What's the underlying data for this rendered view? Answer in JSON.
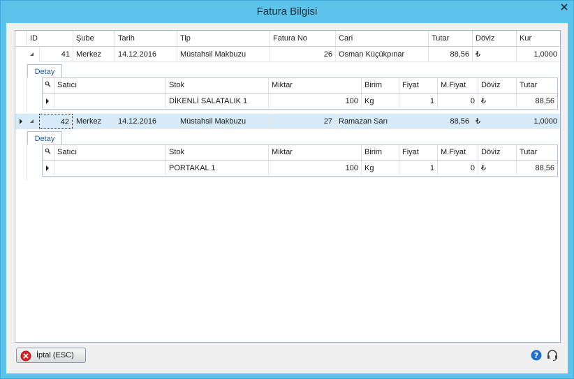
{
  "window": {
    "title": "Fatura Bilgisi"
  },
  "grid": {
    "columns": [
      "ID",
      "Şube",
      "Tarih",
      "Tip",
      "Fatura No",
      "Cari",
      "Tutar",
      "Döviz",
      "Kur"
    ],
    "rows": [
      {
        "id": "41",
        "sube": "Merkez",
        "tarih": "14.12.2016",
        "tip": "Müstahsil Makbuzu",
        "fatura_no": "26",
        "cari": "Osman Küçükpınar",
        "tutar": "88,56",
        "doviz": "₺",
        "kur": "1,0000"
      },
      {
        "id": "42",
        "sube": "Merkez",
        "tarih": "14.12.2016",
        "tip": "Müstahsil Makbuzu",
        "fatura_no": "27",
        "cari": "Ramazan Sarı",
        "tutar": "88,56",
        "doviz": "₺",
        "kur": "1,0000"
      }
    ]
  },
  "detail": {
    "tab_label": "Detay",
    "columns": [
      "Satıcı",
      "Stok",
      "Miktar",
      "Birim",
      "Fiyat",
      "M.Fiyat",
      "Döviz",
      "Tutar"
    ],
    "rows": [
      {
        "satici": "",
        "stok": "DİKENLİ SALATALIK 1",
        "miktar": "100",
        "birim": "Kg",
        "fiyat": "1",
        "mfiyat": "0",
        "doviz": "₺",
        "tutar": "88,56"
      },
      {
        "satici": "",
        "stok": "PORTAKAL 1",
        "miktar": "100",
        "birim": "Kg",
        "fiyat": "1",
        "mfiyat": "0",
        "doviz": "₺",
        "tutar": "88,56"
      }
    ]
  },
  "footer": {
    "cancel_label": "İptal (ESC)"
  },
  "colors": {
    "frame": "#5cc4ea",
    "selected_row": "#d6eaf7",
    "tab_text": "#1f5fa0"
  }
}
